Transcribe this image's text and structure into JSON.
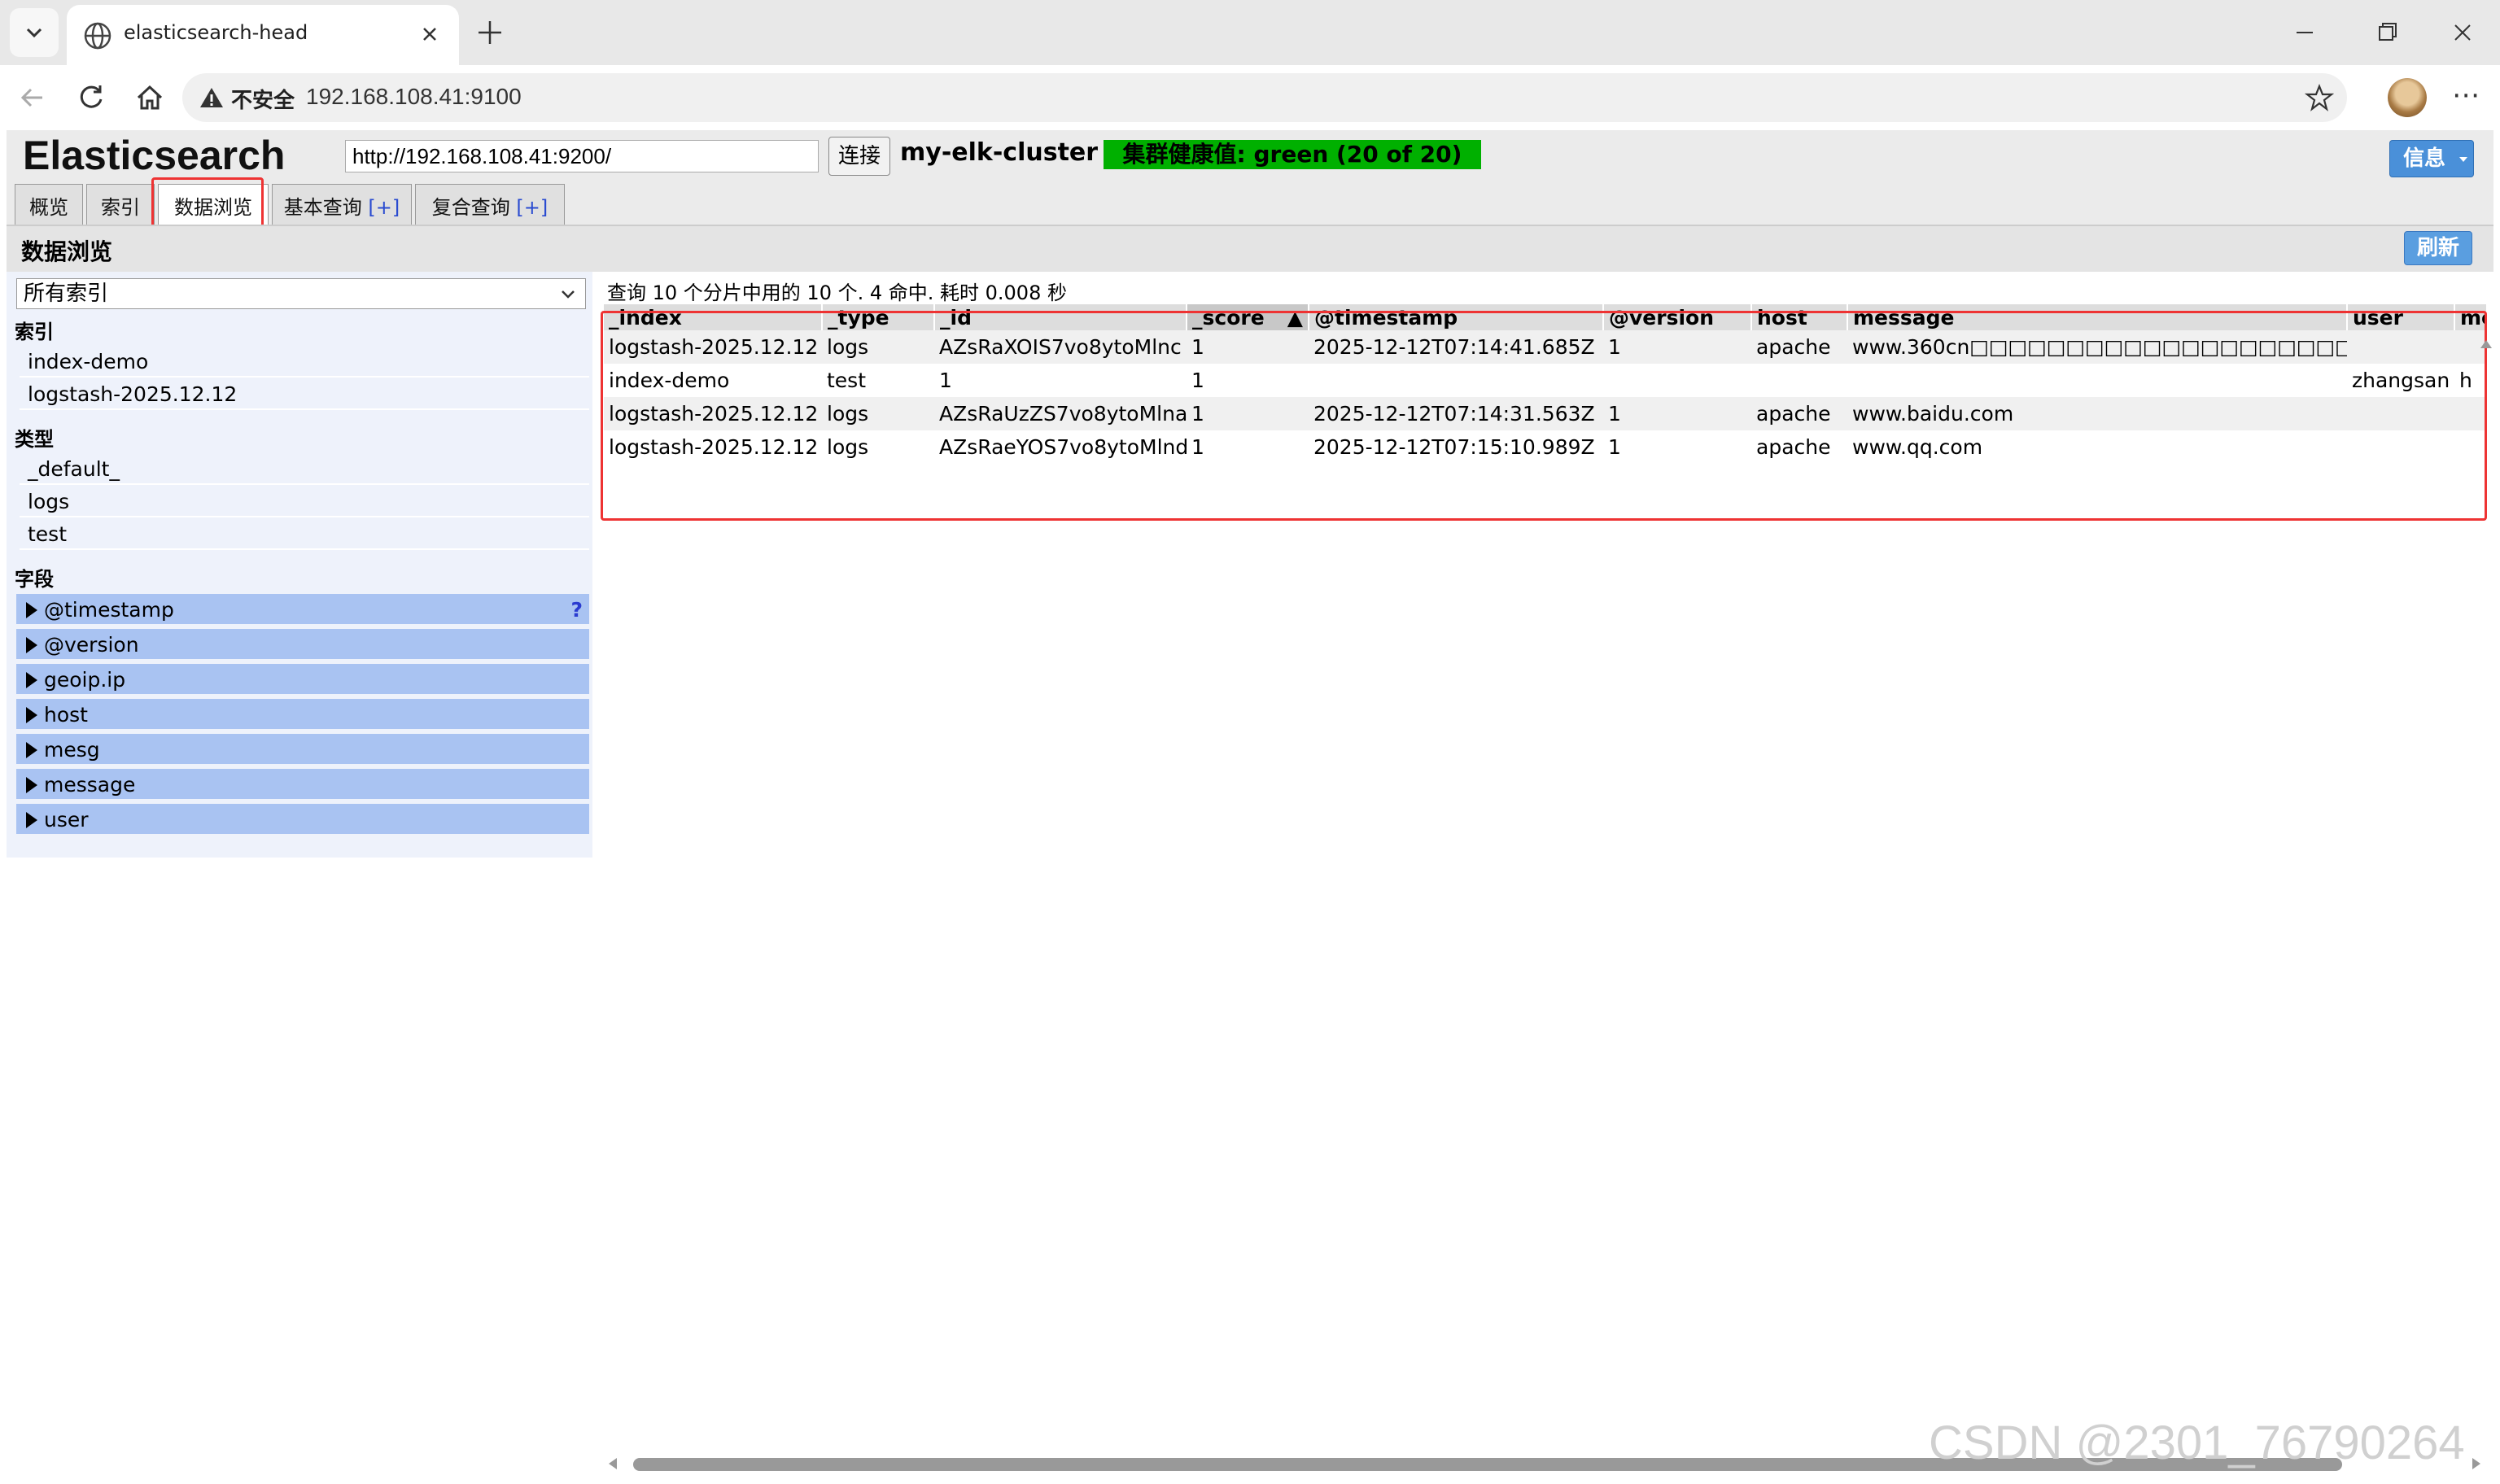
{
  "browser": {
    "tab_title": "elasticsearch-head",
    "security_label": "不安全",
    "address": "192.168.108.41:9100"
  },
  "header": {
    "logo": "Elasticsearch",
    "cluster_url": "http://192.168.108.41:9200/",
    "connect_label": "连接",
    "cluster_name": "my-elk-cluster",
    "health": "集群健康值: green (20 of 20)",
    "health_color": "#00b000",
    "info_label": "信息"
  },
  "tabs": [
    {
      "label": "概览"
    },
    {
      "label": "索引"
    },
    {
      "label": "数据浏览"
    },
    {
      "label": "基本查询",
      "plus": "[+]"
    },
    {
      "label": "复合查询",
      "plus": "[+]"
    }
  ],
  "section": {
    "title": "数据浏览",
    "refresh_label": "刷新"
  },
  "sidebar": {
    "selected_index": "所有索引",
    "indices_header": "索引",
    "indices": [
      "index-demo",
      "logstash-2025.12.12"
    ],
    "types_header": "类型",
    "types": [
      "_default_",
      "logs",
      "test"
    ],
    "fields_header": "字段",
    "fields": [
      "@timestamp",
      "@version",
      "geoip.ip",
      "host",
      "mesg",
      "message",
      "user"
    ],
    "help_mark": "?"
  },
  "results": {
    "summary": "查询 10 个分片中用的 10 个. 4 命中. 耗时 0.008 秒",
    "sort_indicator": "▲",
    "columns": [
      "_index",
      "_type",
      "_id",
      "_score",
      "@timestamp",
      "@version",
      "host",
      "message",
      "user",
      "me"
    ],
    "rows": [
      [
        "logstash-2025.12.12",
        "logs",
        "AZsRaXOIS7vo8ytoMlnc",
        "1",
        "2025-12-12T07:14:41.685Z",
        "1",
        "apache",
        "www.360cn□□□□□□□□□□□□□□□□□□□□□",
        "",
        ""
      ],
      [
        "index-demo",
        "test",
        "1",
        "1",
        "",
        "",
        "",
        "",
        "zhangsan",
        "h"
      ],
      [
        "logstash-2025.12.12",
        "logs",
        "AZsRaUzZS7vo8ytoMlna",
        "1",
        "2025-12-12T07:14:31.563Z",
        "1",
        "apache",
        "www.baidu.com",
        "",
        ""
      ],
      [
        "logstash-2025.12.12",
        "logs",
        "AZsRaeYOS7vo8ytoMlnd",
        "1",
        "2025-12-12T07:15:10.989Z",
        "1",
        "apache",
        "www.qq.com",
        "",
        ""
      ]
    ]
  },
  "watermark": "CSDN @2301_76790264"
}
